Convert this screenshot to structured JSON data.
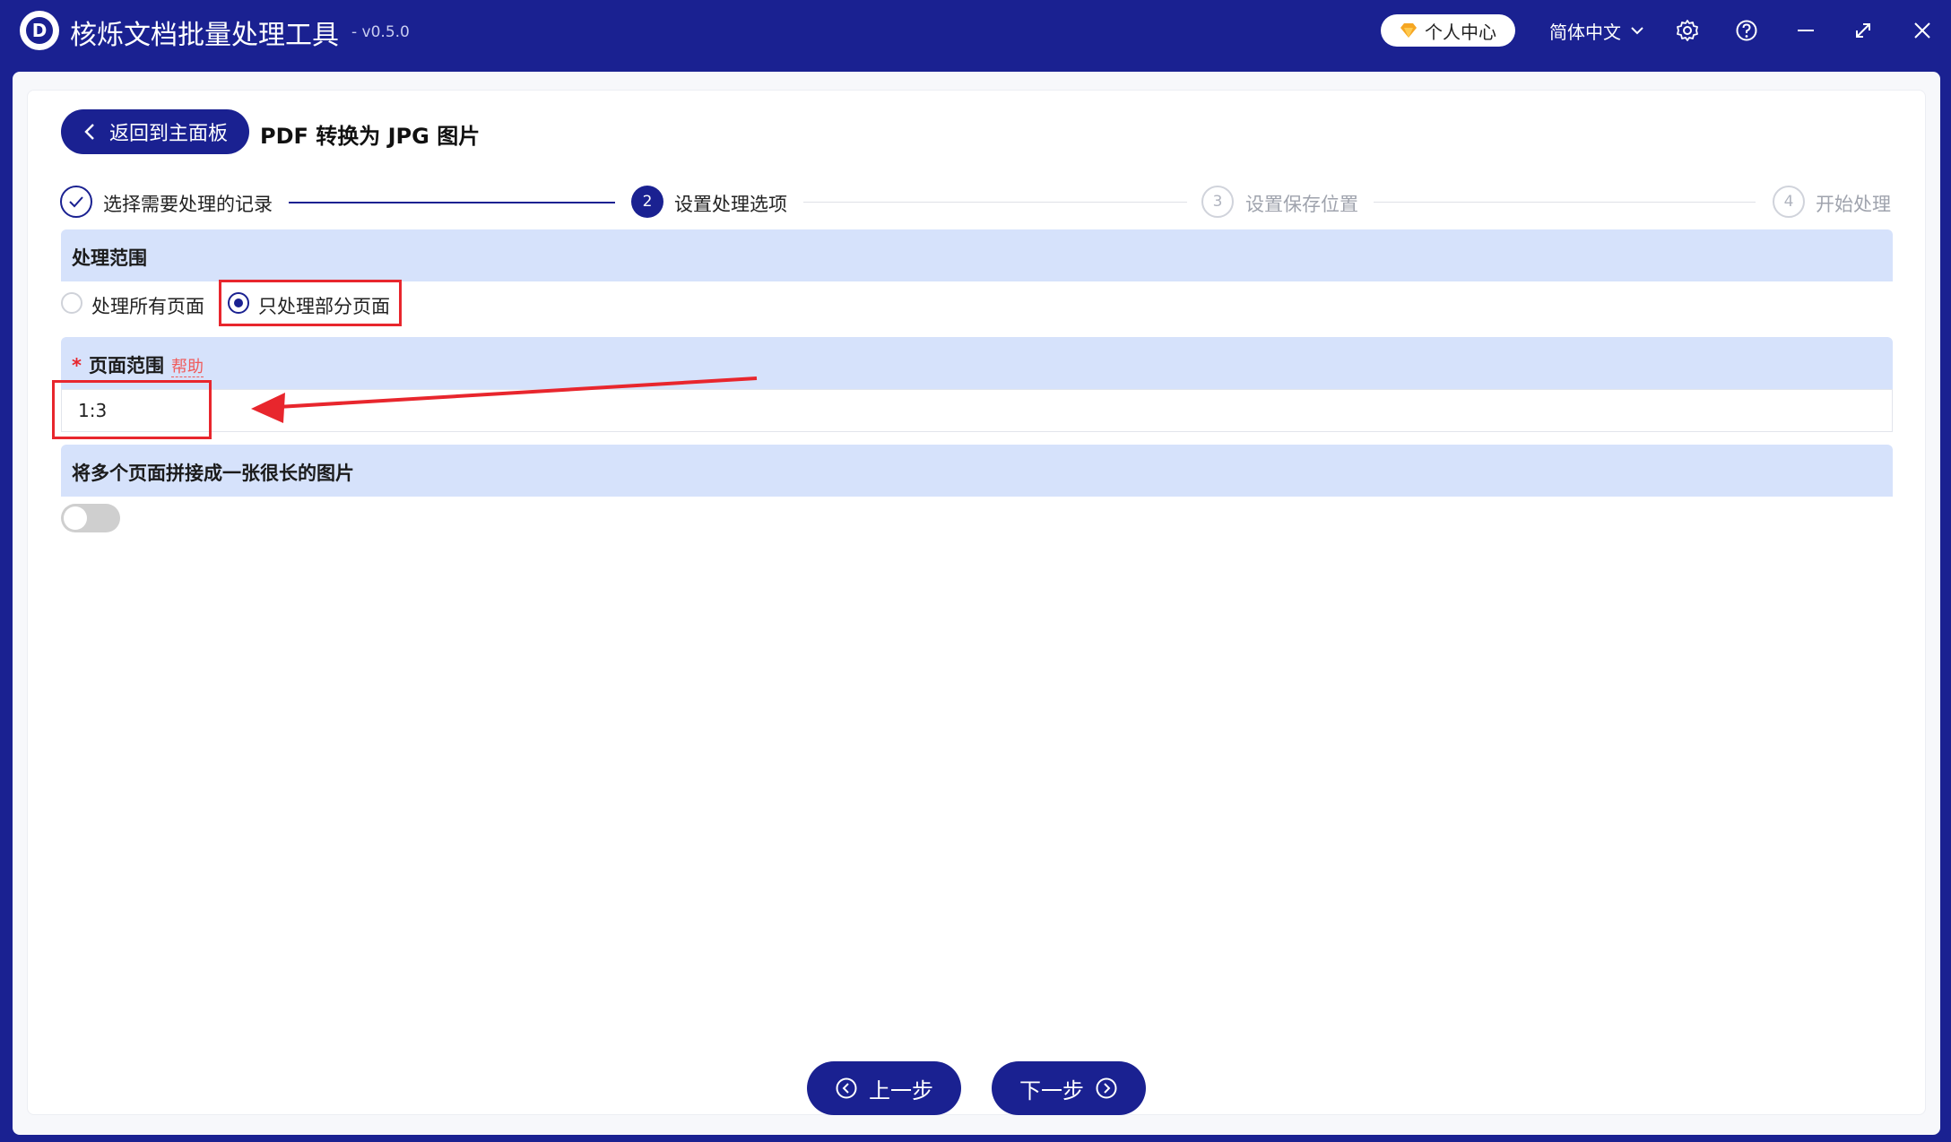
{
  "titlebar": {
    "logo_letter": "D",
    "app_name": "核烁文档批量处理工具",
    "version": "- v0.5.0",
    "user_center": "个人中心",
    "language": "简体中文"
  },
  "header": {
    "back_label": "返回到主面板",
    "page_title": "PDF 转换为 JPG 图片"
  },
  "steps": [
    {
      "number": "",
      "label": "选择需要处理的记录",
      "state": "done"
    },
    {
      "number": "2",
      "label": "设置处理选项",
      "state": "active"
    },
    {
      "number": "3",
      "label": "设置保存位置",
      "state": "todo"
    },
    {
      "number": "4",
      "label": "开始处理",
      "state": "todo"
    }
  ],
  "range_section": {
    "title": "处理范围",
    "options": [
      "处理所有页面",
      "只处理部分页面"
    ],
    "selected": "只处理部分页面"
  },
  "page_range": {
    "required_mark": "*",
    "title": "页面范围",
    "help": "帮助",
    "value": "1:3"
  },
  "merge_section": {
    "title": "将多个页面拼接成一张很长的图片",
    "enabled": false
  },
  "footer": {
    "prev_label": "上一步",
    "next_label": "下一步"
  },
  "colors": {
    "brand": "#1a2191",
    "section_bg": "#d6e2fb",
    "highlight": "#e8262d"
  }
}
